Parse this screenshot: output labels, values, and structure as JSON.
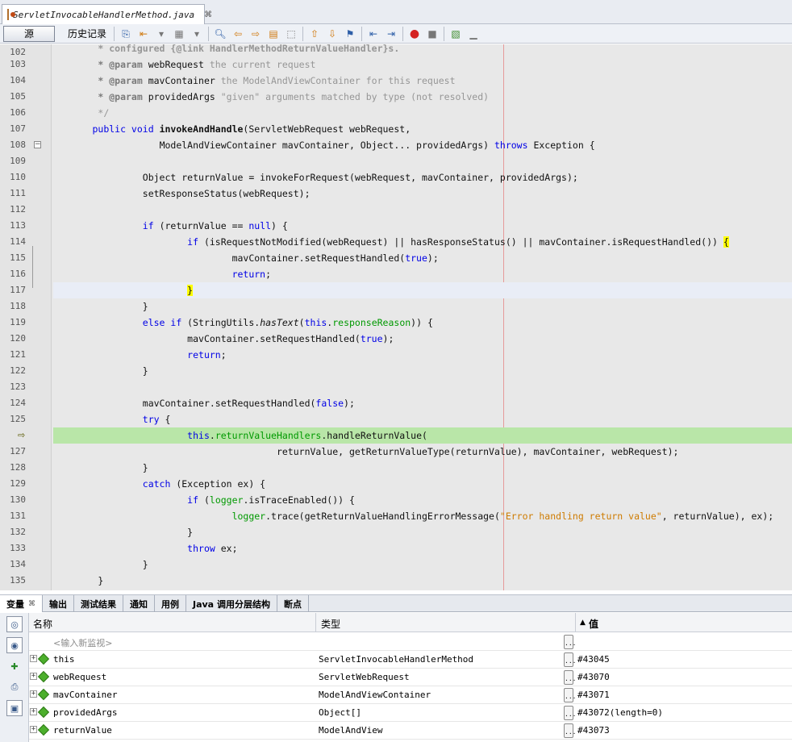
{
  "tab": {
    "filename": "ServletInvocableHandlerMethod.java",
    "close": "⌘"
  },
  "toolbar": {
    "source_label": "源",
    "history_label": "历史记录"
  },
  "editor": {
    "lines": [
      102,
      103,
      104,
      105,
      106,
      107,
      108,
      109,
      110,
      111,
      112,
      113,
      114,
      115,
      116,
      117,
      118,
      119,
      120,
      121,
      122,
      123,
      124,
      125,
      126,
      127,
      128,
      129,
      130,
      131,
      132,
      133,
      134,
      135
    ],
    "current_line": 126
  },
  "code": {
    "l102": "* configured {@link HandlerMethodReturnValueHandler}s.",
    "l103a": "* @param",
    "l103b": " webRequest ",
    "l103c": "the current request",
    "l104a": "* @param",
    "l104b": " mavContainer ",
    "l104c": "the ModelAndViewContainer for this request",
    "l105a": "* @param",
    "l105b": " providedArgs ",
    "l105c": "\"given\" arguments matched by type (not resolved)",
    "l106": "*/",
    "l107a": "public void ",
    "l107b": "invokeAndHandle",
    "l107c": "(ServletWebRequest webRequest,",
    "l108a": "ModelAndViewContainer mavContainer, Object... providedArgs) ",
    "l108b": "throws",
    "l108c": " Exception {",
    "l110": "Object returnValue = invokeForRequest(webRequest, mavContainer, providedArgs);",
    "l111": "setResponseStatus(webRequest);",
    "l113a": "if",
    "l113b": " (returnValue == ",
    "l113c": "null",
    "l113d": ") {",
    "l114a": "if",
    "l114b": " (isRequestNotModified(webRequest) || hasResponseStatus() || mavContainer.isRequestHandled()) ",
    "l114c": "{",
    "l115a": "mavContainer.setRequestHandled(",
    "l115b": "true",
    "l115c": ");",
    "l116": "return",
    "l117": "}",
    "l118": "}",
    "l119a": "else if",
    "l119b": " (StringUtils.",
    "l119c": "hasText",
    "l119d": "(",
    "l119e": "this",
    "l119f": ".",
    "l119g": "responseReason",
    "l119h": ")) {",
    "l120a": "mavContainer.setRequestHandled(",
    "l120b": "true",
    "l120c": ");",
    "l121": "return",
    "l122": "}",
    "l124a": "mavContainer.setRequestHandled(",
    "l124b": "false",
    "l124c": ");",
    "l125a": "try",
    "l125b": " {",
    "l126a": "this",
    "l126b": ".",
    "l126c": "returnValueHandlers",
    "l126d": ".handleReturnValue(",
    "l127": "returnValue, getReturnValueType(returnValue), mavContainer, webRequest);",
    "l128": "}",
    "l129a": "catch",
    "l129b": " (Exception ex) {",
    "l130a": "if",
    "l130b": " (",
    "l130c": "logger",
    "l130d": ".isTraceEnabled()) {",
    "l131a": "logger",
    "l131b": ".trace(getReturnValueHandlingErrorMessage(",
    "l131c": "\"Error handling return value\"",
    "l131d": ", returnValue), ex);",
    "l132": "}",
    "l133a": "throw",
    "l133b": " ex;",
    "l134": "}",
    "l135": "}",
    "semi": ";"
  },
  "debug": {
    "tabs": [
      "变量",
      "输出",
      "测试结果",
      "通知",
      "用例",
      "Java 调用分层结构",
      "断点"
    ],
    "tab_close": "⌘",
    "columns": {
      "name": "名称",
      "type": "类型",
      "value": "值",
      "sort_arrow": "▲"
    },
    "placeholder": "<输入新监视>",
    "rows": [
      {
        "name": "this",
        "type": "ServletInvocableHandlerMethod",
        "value": "#43045"
      },
      {
        "name": "webRequest",
        "type": "ServletWebRequest",
        "value": "#43070"
      },
      {
        "name": "mavContainer",
        "type": "ModelAndViewContainer",
        "value": "#43071"
      },
      {
        "name": "providedArgs",
        "type": "Object[]",
        "value": "#43072(length=0)"
      },
      {
        "name": "returnValue",
        "type": "ModelAndView",
        "value": "#43073"
      }
    ]
  },
  "icons": {
    "file": "java-file-icon",
    "ellipsis": "..."
  }
}
